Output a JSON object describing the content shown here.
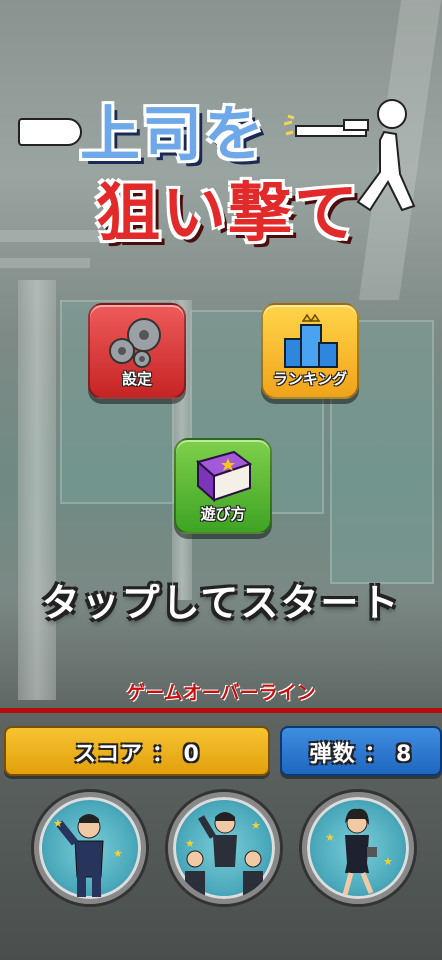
{
  "title": {
    "line1": "上司を",
    "line2": "狙い撃て"
  },
  "menu": {
    "settings_label": "設定",
    "ranking_label": "ランキング",
    "howto_label": "遊び方"
  },
  "start_prompt": "タップしてスタート",
  "gameover_line_label": "ゲームオーバーライン",
  "hud": {
    "score_text": "スコア ： 0",
    "ammo_text": "弾数 ： 8"
  },
  "colors": {
    "gameover_line": "#b40d0d",
    "score_box": "#f7c331",
    "ammo_box": "#3f8de0"
  },
  "icons": {
    "settings": "gear-icon",
    "ranking": "trophy-bars-icon",
    "howto": "book-icon"
  }
}
